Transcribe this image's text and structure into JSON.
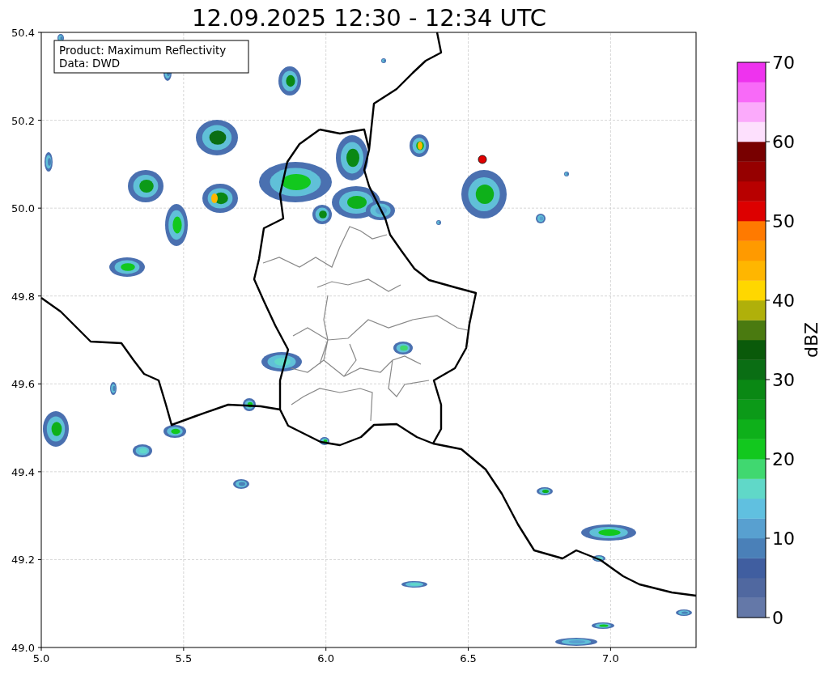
{
  "title": "12.09.2025 12:30 - 12:34 UTC",
  "annotation": [
    "Product: Maximum Reflectivity",
    "Data: DWD"
  ],
  "x_ticks": [
    "5.0",
    "5.5",
    "6.0",
    "6.5",
    "7.0"
  ],
  "y_ticks": [
    "50.4",
    "50.2",
    "50.0",
    "49.8",
    "49.6",
    "49.4",
    "49.2",
    "49.0"
  ],
  "colorbar": {
    "label": "dBZ",
    "ticks": [
      "70",
      "60",
      "50",
      "40",
      "30",
      "20",
      "10",
      "0"
    ],
    "segments": [
      {
        "color": "#6478a8"
      },
      {
        "color": "#5068a0"
      },
      {
        "color": "#405ea0"
      },
      {
        "color": "#4a80b8"
      },
      {
        "color": "#58a0d0"
      },
      {
        "color": "#60c0e0"
      },
      {
        "color": "#60d8c8"
      },
      {
        "color": "#40d870"
      },
      {
        "color": "#12c81e"
      },
      {
        "color": "#0eb01a"
      },
      {
        "color": "#0c9a18"
      },
      {
        "color": "#0a8814"
      },
      {
        "color": "#0a6e14"
      },
      {
        "color": "#0a5a0a"
      },
      {
        "color": "#4a7a10"
      },
      {
        "color": "#b0b00a"
      },
      {
        "color": "#ffd700"
      },
      {
        "color": "#ffb600"
      },
      {
        "color": "#ff9a00"
      },
      {
        "color": "#ff7a00"
      },
      {
        "color": "#dd0000"
      },
      {
        "color": "#b80000"
      },
      {
        "color": "#960000"
      },
      {
        "color": "#780000"
      },
      {
        "color": "#fde0fd"
      },
      {
        "color": "#fbaafb"
      },
      {
        "color": "#f86af8"
      },
      {
        "color": "#ee33ee"
      }
    ]
  }
}
